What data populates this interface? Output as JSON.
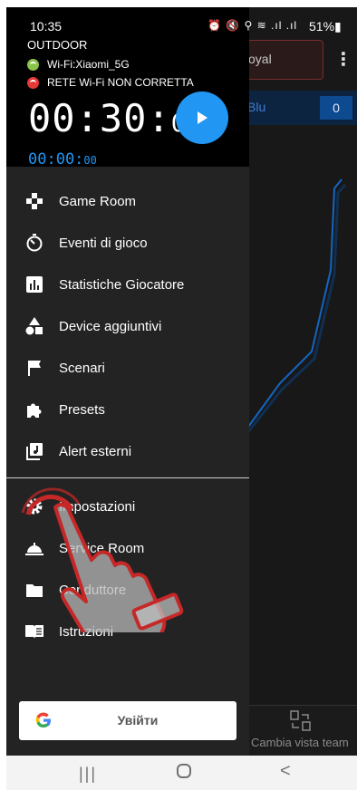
{
  "status_bar": {
    "time": "10:35",
    "icons": "⏰ 🔇 ⚲ ≋ .ıl .ıl",
    "battery": "51%▮"
  },
  "background_app": {
    "header_partial_text": "oyal",
    "team_partial_label": "Blu",
    "team_score": "0",
    "bottom_action_label": "Cambia vista team"
  },
  "drawer": {
    "mode": "OUTDOOR",
    "wifi_name": "Wi-Fi:Xiaomi_5G",
    "wifi_status": "RETE Wi-Fi NON CORRETTA",
    "timer_main_big": "00:30:",
    "timer_main_small": "00",
    "timer_sub_big": "00:00:",
    "timer_sub_small": "00",
    "menu_items": [
      {
        "label": "Game Room",
        "icon": "gamepad-icon"
      },
      {
        "label": "Eventi di gioco",
        "icon": "timer-icon"
      },
      {
        "label": "Statistiche Giocatore",
        "icon": "bar-chart-icon"
      },
      {
        "label": "Device aggiuntivi",
        "icon": "shapes-icon"
      },
      {
        "label": "Scenari",
        "icon": "flag-icon"
      },
      {
        "label": "Presets",
        "icon": "puzzle-icon"
      },
      {
        "label": "Alert esterni",
        "icon": "music-library-icon"
      },
      {
        "label": "Impostazioni",
        "icon": "gear-icon"
      },
      {
        "label": "Service Room",
        "icon": "service-bell-icon"
      },
      {
        "label": "Conduttore",
        "icon": "folder-icon"
      },
      {
        "label": "Istruzioni",
        "icon": "book-icon"
      }
    ],
    "google_button_label": "Увійти"
  },
  "colors": {
    "accent_blue": "#2196f3",
    "wifi_ok": "#8bc34a",
    "wifi_error": "#e53935",
    "drawer_bg": "#232323"
  }
}
